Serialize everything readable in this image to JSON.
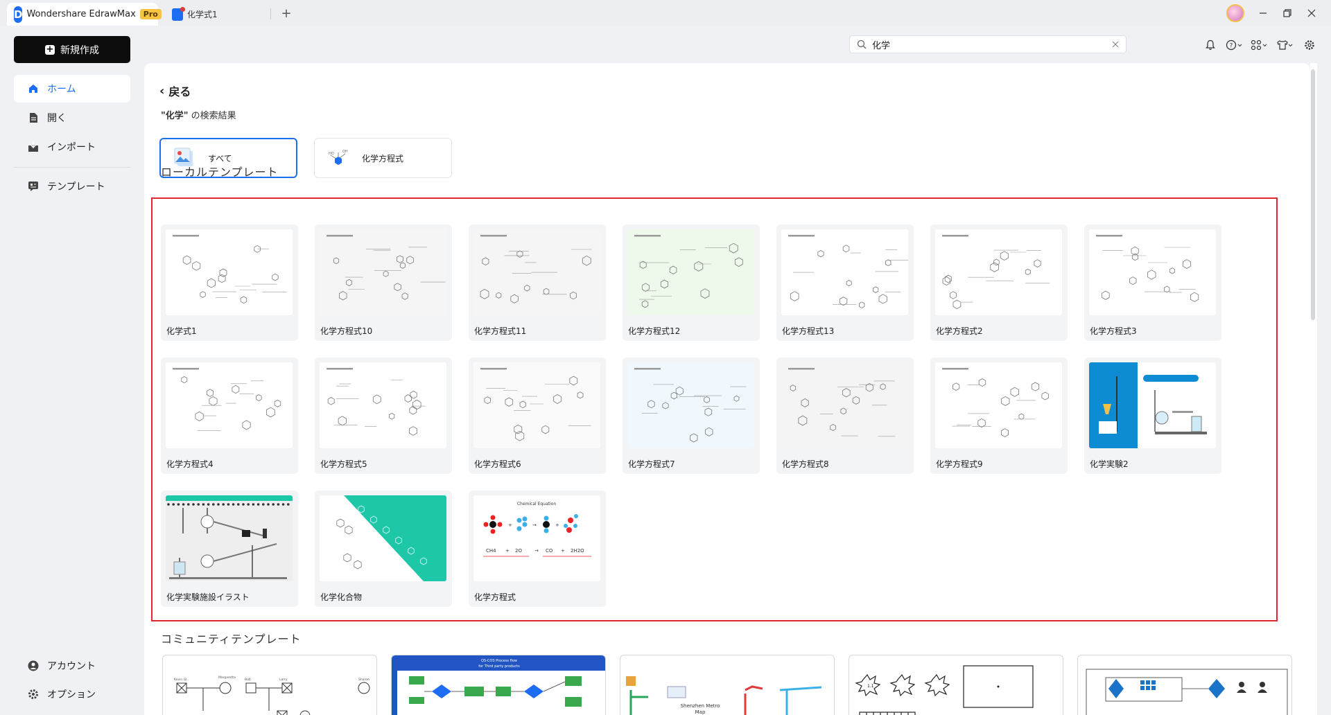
{
  "titlebar": {
    "app_name": "Wondershare EdrawMax",
    "pro_badge": "Pro",
    "doc_tab": "化学式1",
    "new_tab": "+"
  },
  "sidebar": {
    "new_button": "新規作成",
    "items": [
      {
        "label": "ホーム",
        "icon": "home-icon",
        "active": true
      },
      {
        "label": "開く",
        "icon": "file-icon",
        "active": false
      },
      {
        "label": "インポート",
        "icon": "import-icon",
        "active": false
      },
      {
        "label": "テンプレート",
        "icon": "template-icon",
        "active": false
      }
    ],
    "bottom": [
      {
        "label": "アカウント",
        "icon": "account-icon"
      },
      {
        "label": "オプション",
        "icon": "gear-icon"
      }
    ]
  },
  "search": {
    "value": "化学"
  },
  "main": {
    "back_label": "戻る",
    "result_query": "\"化学\"",
    "result_suffix": " の検索結果",
    "filters": [
      {
        "label": "すべて",
        "selected": true
      },
      {
        "label": "化学方程式",
        "selected": false
      }
    ],
    "local_section": "ローカルテンプレート",
    "community_section": "コミュニティテンプレート",
    "templates": [
      {
        "name": "化学式1"
      },
      {
        "name": "化学方程式10"
      },
      {
        "name": "化学方程式11"
      },
      {
        "name": "化学方程式12"
      },
      {
        "name": "化学方程式13"
      },
      {
        "name": "化学方程式2"
      },
      {
        "name": "化学方程式3"
      },
      {
        "name": "化学方程式4"
      },
      {
        "name": "化学方程式5"
      },
      {
        "name": "化学方程式6"
      },
      {
        "name": "化学方程式7"
      },
      {
        "name": "化学方程式8"
      },
      {
        "name": "化学方程式9"
      },
      {
        "name": "化学実験2"
      },
      {
        "name": "化学実験施設イラスト"
      },
      {
        "name": "化学化合物"
      },
      {
        "name": "化学方程式"
      }
    ]
  },
  "colors": {
    "accent": "#1d6cf4",
    "highlight_box": "#e0262e",
    "teal": "#1dc7a8"
  }
}
